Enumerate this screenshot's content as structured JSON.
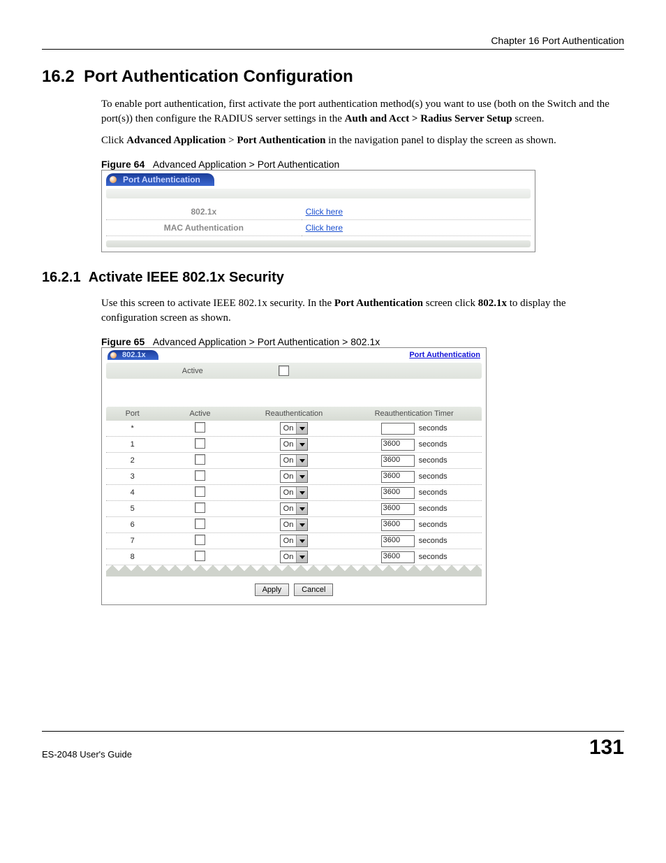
{
  "header": {
    "chapter": "Chapter 16 Port Authentication"
  },
  "section": {
    "number": "16.2",
    "title": "Port Authentication Configuration",
    "para1_a": "To enable port authentication, first activate the port authentication method(s) you want to use (both on the Switch and the port(s)) then configure the RADIUS server settings in the ",
    "para1_b": "Auth and Acct > Radius Server Setup",
    "para1_c": " screen.",
    "para2_a": "Click ",
    "para2_b": "Advanced Application",
    "para2_c": " > ",
    "para2_d": "Port Authentication",
    "para2_e": " in the navigation panel to display the screen as shown."
  },
  "figure64": {
    "label": "Figure 64",
    "caption": "Advanced Application > Port Authentication",
    "tab": "Port Authentication",
    "row1_label": "802.1x",
    "row1_link": "Click here",
    "row2_label": "MAC Authentication",
    "row2_link": "Click here"
  },
  "subsection": {
    "number": "16.2.1",
    "title": "Activate IEEE 802.1x Security",
    "para_a": "Use this screen to activate IEEE 802.1x security. In the ",
    "para_b": "Port Authentication",
    "para_c": " screen click ",
    "para_d": "802.1x",
    "para_e": " to display the configuration screen as shown."
  },
  "figure65": {
    "label": "Figure 65",
    "caption": "Advanced Application > Port Authentication > 802.1x",
    "tab": "802.1x",
    "top_link": "Port Authentication",
    "active_label": "Active",
    "headers": {
      "port": "Port",
      "active": "Active",
      "reauth": "Reauthentication",
      "timer": "Reauthentication Timer"
    },
    "select_value": "On",
    "seconds": "seconds",
    "rows": [
      {
        "port": "*",
        "timer": ""
      },
      {
        "port": "1",
        "timer": "3600"
      },
      {
        "port": "2",
        "timer": "3600"
      },
      {
        "port": "3",
        "timer": "3600"
      },
      {
        "port": "4",
        "timer": "3600"
      },
      {
        "port": "5",
        "timer": "3600"
      },
      {
        "port": "6",
        "timer": "3600"
      },
      {
        "port": "7",
        "timer": "3600"
      },
      {
        "port": "8",
        "timer": "3600"
      }
    ],
    "apply": "Apply",
    "cancel": "Cancel"
  },
  "footer": {
    "guide": "ES-2048 User's Guide",
    "page": "131"
  }
}
